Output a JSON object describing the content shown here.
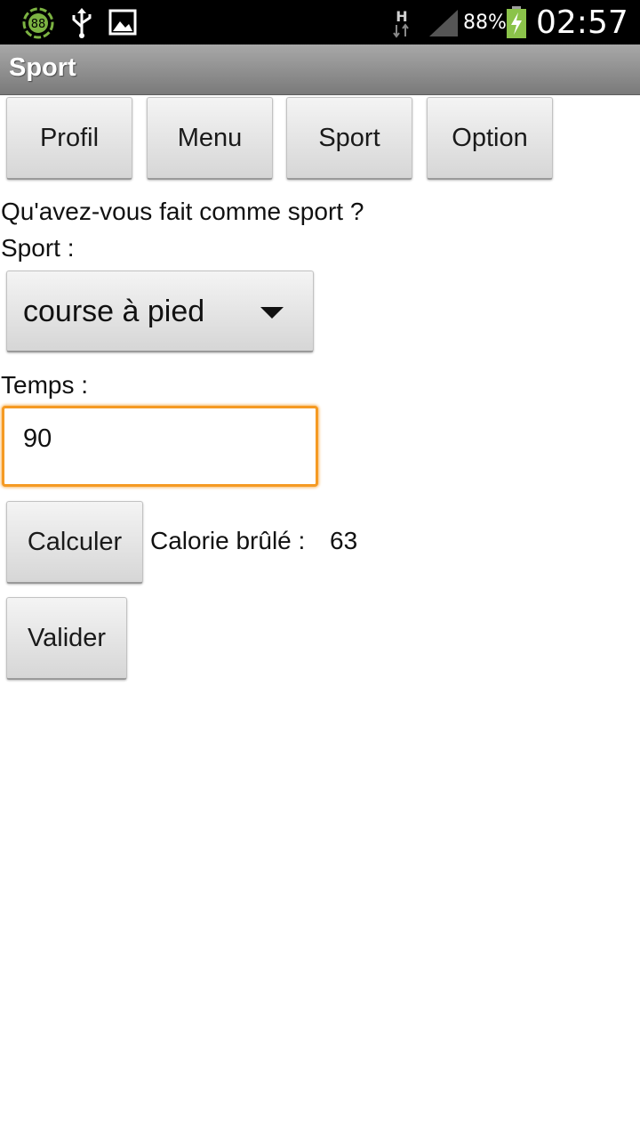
{
  "status_bar": {
    "notification_badge": "88",
    "icons": [
      "badge-88-icon",
      "usb-icon",
      "image-icon",
      "network-h-icon",
      "signal-icon",
      "battery-charging-icon"
    ],
    "battery_percent": "88%",
    "time": "02:57",
    "battery_color": "#8bc34a",
    "badge_color": "#7cb342"
  },
  "title_bar": {
    "title": "Sport"
  },
  "nav": {
    "profil": "Profil",
    "menu": "Menu",
    "sport": "Sport",
    "option": "Option"
  },
  "form": {
    "question": "Qu'avez-vous fait comme sport ?",
    "sport_label": "Sport :",
    "sport_selected": "course à pied",
    "temps_label": "Temps :",
    "temps_value": "90",
    "calculer": "Calculer",
    "calorie_label": "Calorie brûlé :",
    "calorie_value": "63",
    "valider": "Valider",
    "focus_color": "#f59a23"
  }
}
